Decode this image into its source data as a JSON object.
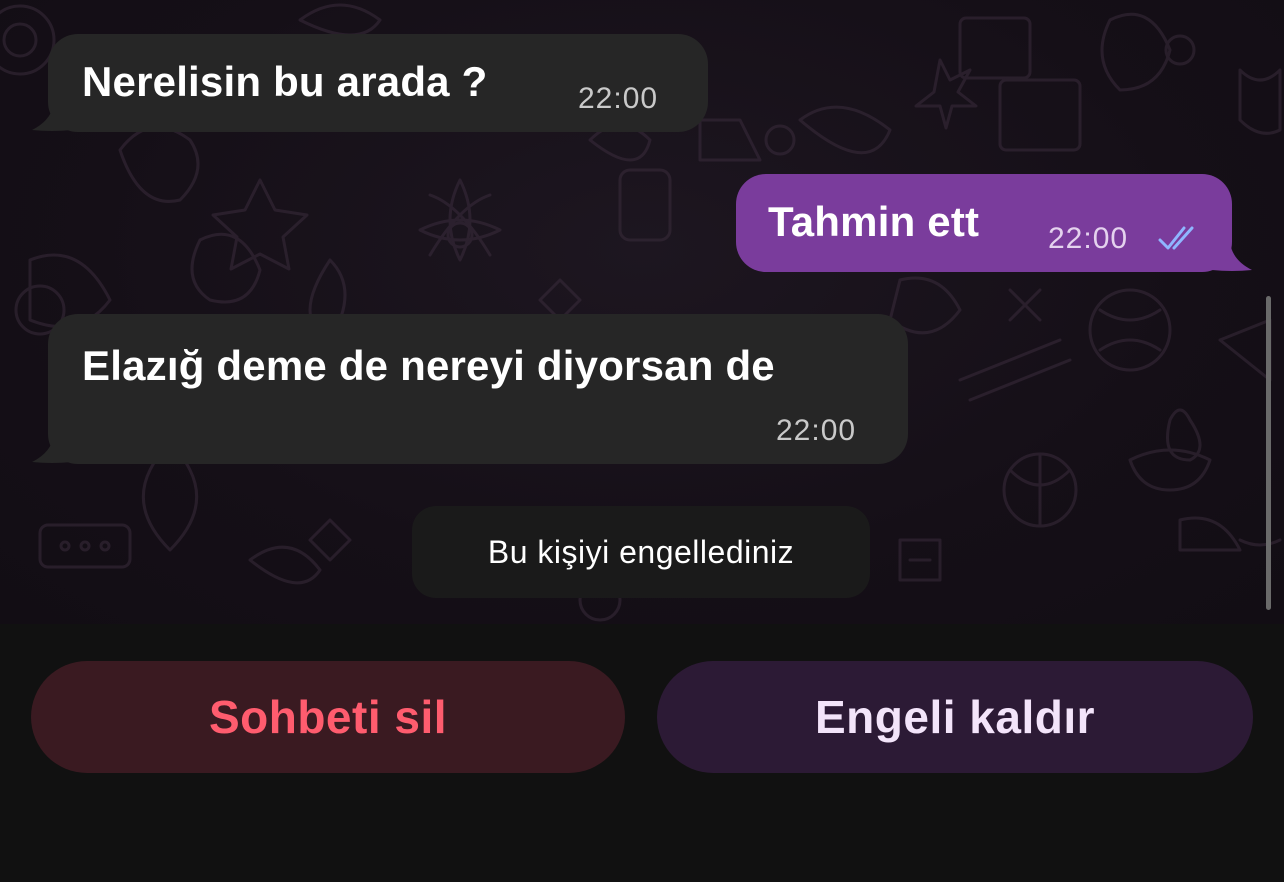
{
  "chat": {
    "messages": [
      {
        "direction": "incoming",
        "text": "Nerelisin bu arada ?",
        "time": "22:00"
      },
      {
        "direction": "outgoing",
        "text": "Tahmin ett",
        "time": "22:00",
        "status_icon": "double-check-icon"
      },
      {
        "direction": "incoming",
        "text": "Elazığ deme de nereyi diyorsan de",
        "time": "22:00"
      }
    ],
    "system_message": "Bu kişiyi engellediniz"
  },
  "actions": {
    "delete_label": "Sohbeti sil",
    "unblock_label": "Engeli kaldır"
  },
  "colors": {
    "incoming_bubble": "#262626",
    "outgoing_bubble": "#7a3c9c",
    "delete_text": "#ff5c6e",
    "delete_bg": "#3a1a21",
    "unblock_text": "#f3e4fa",
    "unblock_bg": "#2c1a35",
    "read_ticks": "#8fb6ff"
  }
}
